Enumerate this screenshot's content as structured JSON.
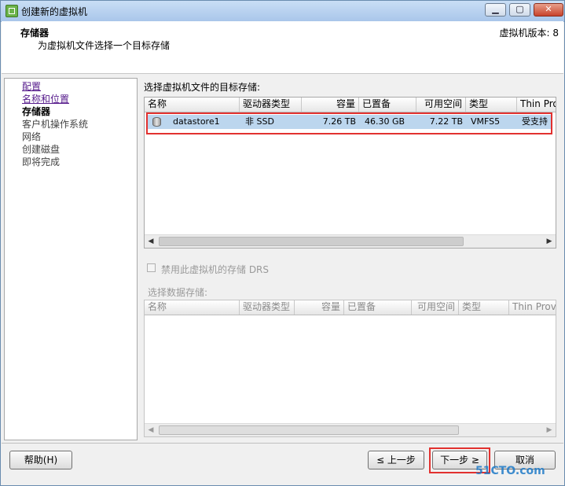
{
  "window": {
    "title": "创建新的虚拟机",
    "controls": {
      "minimize": "▁",
      "maximize": "▢",
      "close": "✕"
    }
  },
  "header": {
    "title": "存储器",
    "subtitle": "为虚拟机文件选择一个目标存储",
    "version": "虚拟机版本: 8"
  },
  "sidebar": {
    "items": [
      {
        "label": "配置",
        "state": "link"
      },
      {
        "label": "名称和位置",
        "state": "link"
      },
      {
        "label": "存储器",
        "state": "current"
      },
      {
        "label": "客户机操作系统",
        "state": "normal"
      },
      {
        "label": "网络",
        "state": "normal"
      },
      {
        "label": "创建磁盘",
        "state": "normal"
      },
      {
        "label": "即将完成",
        "state": "normal"
      }
    ]
  },
  "main": {
    "target_label": "选择虚拟机文件的目标存储:",
    "columns": [
      "名称",
      "驱动器类型",
      "容量",
      "已置备",
      "可用空间",
      "类型",
      "Thin Prov"
    ],
    "rows": [
      {
        "name": "datastore1",
        "drive_type": "非 SSD",
        "capacity": "7.26 TB",
        "provisioned": "46.30 GB",
        "free": "7.22 TB",
        "type": "VMFS5",
        "thin": "受支持"
      }
    ],
    "drs_checkbox_label": "禁用此虚拟机的存储 DRS",
    "select_datastore_label": "选择数据存储:",
    "columns2": [
      "名称",
      "驱动器类型",
      "容量",
      "已置备",
      "可用空间",
      "类型",
      "Thin Provi"
    ]
  },
  "footer": {
    "help": "帮助(H)",
    "back": "≤ 上一步",
    "next": "下一步 ≥",
    "cancel": "取消"
  },
  "watermark": "51CTO.com",
  "colors": {
    "highlight_border": "#e2312f",
    "selected_row": "#bcd6ee"
  }
}
